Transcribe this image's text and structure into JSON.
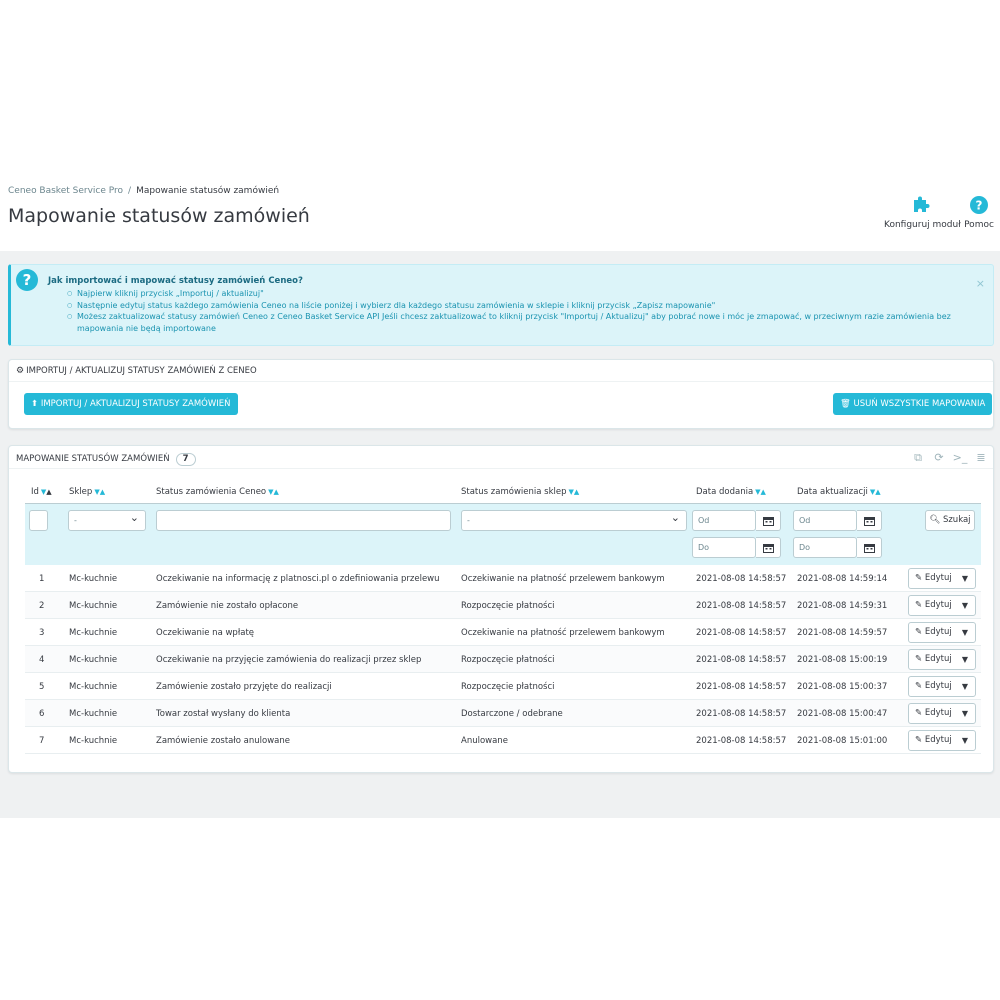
{
  "breadcrumb": {
    "parent": "Ceneo Basket Service Pro",
    "separator": "/",
    "current": "Mapowanie statusów zamówień"
  },
  "page_title": "Mapowanie statusów zamówień",
  "toolbar": {
    "configure_label": "Konfiguruj moduł",
    "configure_icon": "puzzle-icon",
    "help_label": "Pomoc",
    "help_icon": "question-circle-icon"
  },
  "alert": {
    "title": "Jak importować i mapować statusy zamówień Ceneo?",
    "items": [
      "Najpierw kliknij przycisk „Importuj / aktualizuj\"",
      "Następnie edytuj status każdego zamówienia Ceneo na liście poniżej i wybierz dla każdego statusu zamówienia w sklepie i kliknij przycisk „Zapisz mapowanie\"",
      "Możesz zaktualizować statusy zamówień Ceneo z Ceneo Basket Service API Jeśli chcesz zaktualizować to kliknij przycisk \"Importuj / Aktualizuj\" aby pobrać nowe i móc je zmapować, w przeciwnym razie zamówienia bez mapowania nie będą importowane"
    ],
    "close": "×"
  },
  "import_panel": {
    "title": "Importuj / aktualizuj statusy zamówień z Ceneo",
    "import_button": "Importuj / aktualizuj statusy zamówień",
    "delete_button": "Usuń wszystkie mapowania"
  },
  "mapping_panel": {
    "title": "Mapowanie statusów zamówień",
    "count": "7",
    "columns": {
      "id": "Id",
      "shop": "Sklep",
      "ceneo_status": "Status zamówienia Ceneo",
      "shop_status": "Status zamówienia sklep",
      "date_add": "Data dodania",
      "date_upd": "Data aktualizacji"
    },
    "filters": {
      "shop_select": "-",
      "shop_status_select": "-",
      "date_from": "Od",
      "date_to": "Do",
      "search_button": "Szukaj"
    },
    "edit_label": "Edytuj",
    "rows": [
      {
        "id": "1",
        "shop": "Mc-kuchnie",
        "ceneo": "Oczekiwanie na informację z platnosci.pl o zdefiniowania przelewu",
        "status": "Oczekiwanie na płatność przelewem bankowym",
        "added": "2021-08-08 14:58:57",
        "updated": "2021-08-08 14:59:14"
      },
      {
        "id": "2",
        "shop": "Mc-kuchnie",
        "ceneo": "Zamówienie nie zostało opłacone",
        "status": "Rozpoczęcie płatności",
        "added": "2021-08-08 14:58:57",
        "updated": "2021-08-08 14:59:31"
      },
      {
        "id": "3",
        "shop": "Mc-kuchnie",
        "ceneo": "Oczekiwanie na wpłatę",
        "status": "Oczekiwanie na płatność przelewem bankowym",
        "added": "2021-08-08 14:58:57",
        "updated": "2021-08-08 14:59:57"
      },
      {
        "id": "4",
        "shop": "Mc-kuchnie",
        "ceneo": "Oczekiwanie na przyjęcie zamówienia do realizacji przez sklep",
        "status": "Rozpoczęcie płatności",
        "added": "2021-08-08 14:58:57",
        "updated": "2021-08-08 15:00:19"
      },
      {
        "id": "5",
        "shop": "Mc-kuchnie",
        "ceneo": "Zamówienie zostało przyjęte do realizacji",
        "status": "Rozpoczęcie płatności",
        "added": "2021-08-08 14:58:57",
        "updated": "2021-08-08 15:00:37"
      },
      {
        "id": "6",
        "shop": "Mc-kuchnie",
        "ceneo": "Towar został wysłany do klienta",
        "status": "Dostarczone / odebrane",
        "added": "2021-08-08 14:58:57",
        "updated": "2021-08-08 15:00:47"
      },
      {
        "id": "7",
        "shop": "Mc-kuchnie",
        "ceneo": "Zamówienie zostało anulowane",
        "status": "Anulowane",
        "added": "2021-08-08 14:58:57",
        "updated": "2021-08-08 15:01:00"
      }
    ]
  },
  "colors": {
    "accent": "#25b9d7",
    "alert_bg": "#dcf4f9",
    "page_bg": "#eff1f2"
  }
}
